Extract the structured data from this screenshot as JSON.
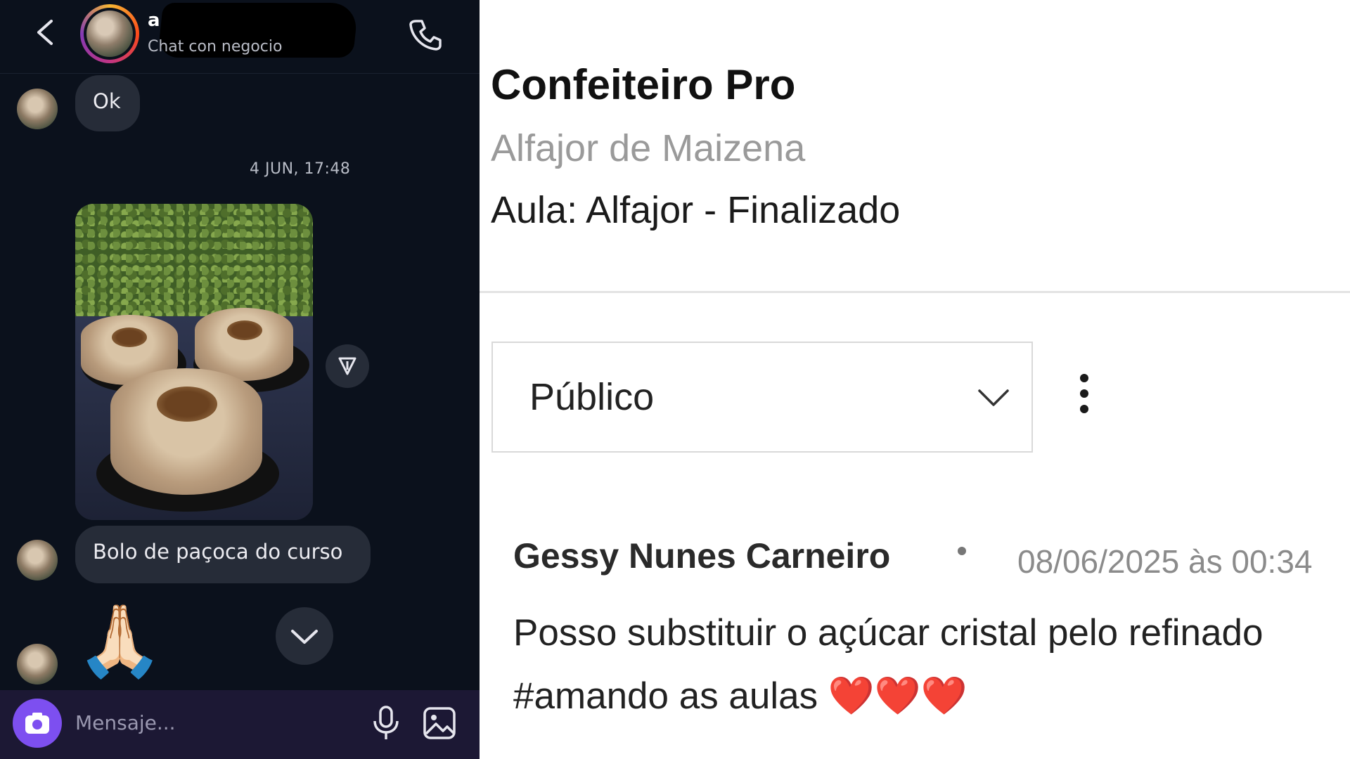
{
  "chat": {
    "header": {
      "name_initial": "a",
      "subtitle": "Chat con negocio"
    },
    "messages": {
      "ok_text": "Ok",
      "timestamp": "4 JUN, 17:48",
      "caption": "Bolo de paçoca do curso",
      "emoji": "🙏🏻"
    },
    "composer": {
      "placeholder": "Mensaje..."
    },
    "accent_color": "#7d4ff0"
  },
  "course_panel": {
    "app_title": "Confeiteiro Pro",
    "course_name": "Alfajor de Maizena",
    "lesson": "Aula: Alfajor - Finalizado",
    "visibility_select": {
      "selected": "Público"
    },
    "comment": {
      "author": "Gessy Nunes Carneiro",
      "date": "08/06/2025 às 00:34",
      "text": "Posso substituir o açúcar cristal pelo refinado #amando as aulas ❤️❤️❤️"
    }
  }
}
